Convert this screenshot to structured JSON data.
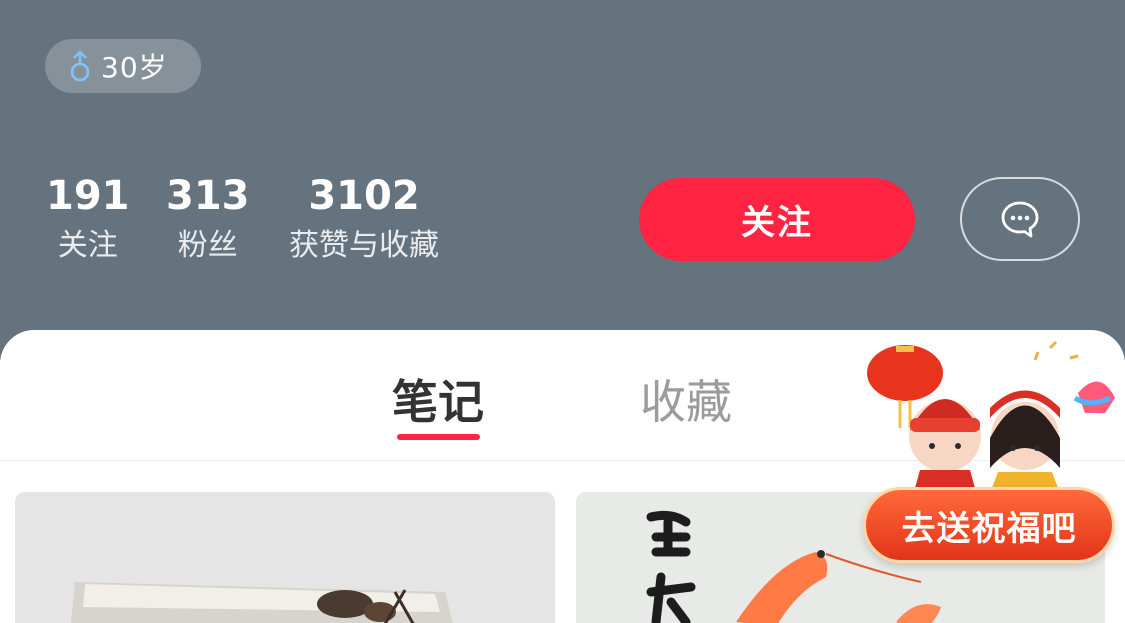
{
  "profile": {
    "age_tag": "30岁",
    "gender_icon": "male-symbol-icon"
  },
  "stats": [
    {
      "value": "191",
      "label": "关注"
    },
    {
      "value": "313",
      "label": "粉丝"
    },
    {
      "value": "3102",
      "label": "获赞与收藏"
    }
  ],
  "actions": {
    "follow_label": "关注",
    "message_icon": "chat-bubble-icon"
  },
  "tabs": [
    {
      "label": "笔记",
      "active": true
    },
    {
      "label": "收藏",
      "active": false
    }
  ],
  "promo": {
    "button_label": "去送祝福吧"
  },
  "colors": {
    "header_bg": "#65737e",
    "accent": "#ff2442",
    "promo": "#e8401e"
  }
}
